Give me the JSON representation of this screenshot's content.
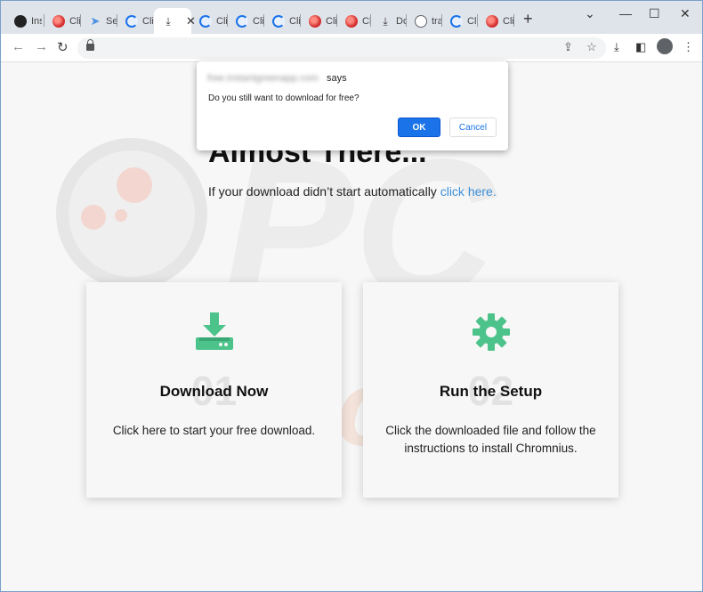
{
  "browser": {
    "tabs": [
      {
        "label": "Ins",
        "icon": "film-icon"
      },
      {
        "label": "Cli",
        "icon": "red-notification-icon"
      },
      {
        "label": "Se",
        "icon": "send-icon"
      },
      {
        "label": "Cli",
        "icon": "edge-icon"
      },
      {
        "label": "",
        "icon": "download-icon",
        "active": true
      },
      {
        "label": "Cli",
        "icon": "edge-icon"
      },
      {
        "label": "Cli",
        "icon": "edge-icon"
      },
      {
        "label": "Cli",
        "icon": "edge-icon"
      },
      {
        "label": "Cli",
        "icon": "red-notification-icon"
      },
      {
        "label": "Cli",
        "icon": "red-notification-icon"
      },
      {
        "label": "Do",
        "icon": "download-icon"
      },
      {
        "label": "tra",
        "icon": "globe-icon"
      },
      {
        "label": "Cli",
        "icon": "edge-icon"
      },
      {
        "label": "Cli",
        "icon": "red-notification-icon"
      }
    ],
    "new_tab": "+",
    "window_controls": {
      "minimize": "⌄",
      "restore": "—",
      "maximize": "☐",
      "close": "✕"
    },
    "url": ""
  },
  "dialog": {
    "host": "free.instantgreenapp.com",
    "says": "says",
    "message": "Do you still want to download for free?",
    "ok_label": "OK",
    "cancel_label": "Cancel"
  },
  "page": {
    "headline": "Almost There...",
    "subline_text": "If your download didn’t start automatically",
    "subline_link": "click here.",
    "cards": [
      {
        "num": "01",
        "title": "Download Now",
        "desc": "Click here to start your free download.",
        "icon": "download-tray-icon"
      },
      {
        "num": "02",
        "title": "Run the Setup",
        "desc": "Click the downloaded file and follow the instructions to install Chromnius.",
        "icon": "gear-icon"
      }
    ],
    "accent_color": "#4cc38a",
    "link_color": "#3b8fd8"
  }
}
